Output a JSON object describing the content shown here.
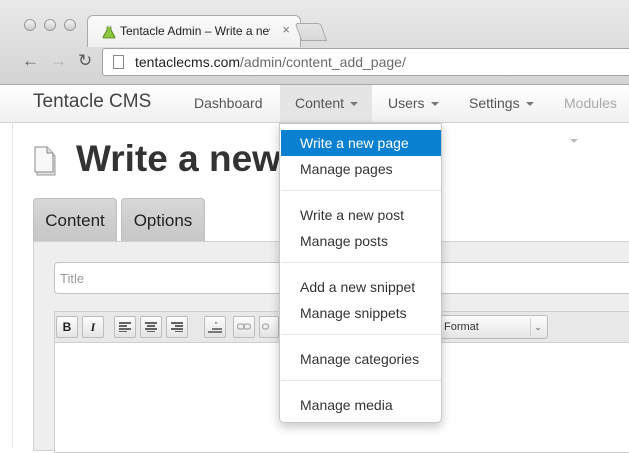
{
  "browser": {
    "tab_title": "Tentacle Admin – Write a new",
    "tab_close": "×",
    "url_host": "tentaclecms.com",
    "url_path": "/admin/content_add_page/",
    "back_icon": "←",
    "forward_icon": "→",
    "reload_icon": "↻"
  },
  "navbar": {
    "brand": "Tentacle CMS",
    "items": [
      {
        "label": "Dashboard"
      },
      {
        "label": "Content"
      },
      {
        "label": "Users"
      },
      {
        "label": "Settings"
      },
      {
        "label": "Modules"
      }
    ]
  },
  "page": {
    "title": "Write a new",
    "tabs": [
      {
        "label": "Content"
      },
      {
        "label": "Options"
      }
    ],
    "title_placeholder": "Title",
    "editor": {
      "bold": "B",
      "italic": "I",
      "format_label": "Format"
    }
  },
  "dropdown": {
    "groups": [
      [
        "Write a new page",
        "Manage pages"
      ],
      [
        "Write a new post",
        "Manage posts"
      ],
      [
        "Add a new snippet",
        "Manage snippets"
      ],
      [
        "Manage categories"
      ],
      [
        "Manage media"
      ]
    ],
    "active_item": "Write a new page"
  },
  "colors": {
    "active_menu_bg": "#0a81d0",
    "active_nav_bg": "#e5e5e5"
  }
}
